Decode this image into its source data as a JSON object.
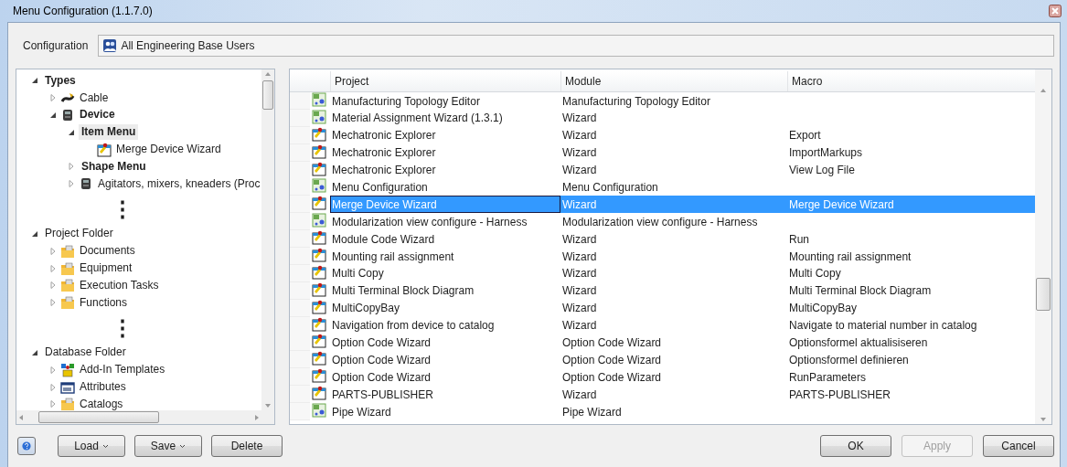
{
  "window": {
    "title": "Menu Configuration (1.1.7.0)"
  },
  "configuration": {
    "label": "Configuration",
    "value": "All Engineering Base Users"
  },
  "tree": [
    {
      "label": "Types",
      "bold": true,
      "expanded": true,
      "selected": false,
      "children": [
        {
          "label": "Cable",
          "kind": "cable",
          "bold": false,
          "expanded": false,
          "selected": false
        },
        {
          "label": "Device",
          "kind": "device",
          "bold": true,
          "expanded": true,
          "selected": false,
          "children": [
            {
              "label": "Item Menu",
              "bold": true,
              "expanded": true,
              "selected": true,
              "children": [
                {
                  "label": "Merge Device Wizard",
                  "kind": "wizard",
                  "bold": false,
                  "selected": false
                }
              ]
            },
            {
              "label": "Shape Menu",
              "bold": true,
              "expanded": false,
              "selected": false
            },
            {
              "label": "Agitators, mixers, kneaders (Proc",
              "kind": "device",
              "bold": false,
              "expanded": false,
              "selected": false
            },
            {
              "label": "⋮",
              "kind": "ellipsis"
            }
          ]
        }
      ]
    },
    {
      "label": "Project Folder",
      "bold": false,
      "expanded": true,
      "selected": false,
      "children": [
        {
          "label": "Documents",
          "kind": "folder",
          "bold": false,
          "expanded": false,
          "selected": false
        },
        {
          "label": "Equipment",
          "kind": "folder",
          "bold": false,
          "expanded": false,
          "selected": false
        },
        {
          "label": "Execution Tasks",
          "kind": "folder",
          "bold": false,
          "expanded": false,
          "selected": false
        },
        {
          "label": "Functions",
          "kind": "folder",
          "bold": false,
          "expanded": false,
          "selected": false
        },
        {
          "label": "⋮",
          "kind": "ellipsis"
        }
      ]
    },
    {
      "label": "Database Folder",
      "bold": false,
      "expanded": true,
      "selected": false,
      "children": [
        {
          "label": "Add-In Templates",
          "kind": "template",
          "bold": false,
          "expanded": false,
          "selected": false
        },
        {
          "label": "Attributes",
          "kind": "attributes",
          "bold": false,
          "expanded": false,
          "selected": false
        },
        {
          "label": "Catalogs",
          "kind": "folder",
          "bold": false,
          "expanded": false,
          "selected": false
        }
      ]
    }
  ],
  "table": {
    "columns": [
      "Project",
      "Module",
      "Macro"
    ],
    "rows": [
      {
        "kind": "module",
        "project": "Manufacturing Topology Editor",
        "module": "Manufacturing Topology Editor",
        "selected": false
      },
      {
        "kind": "module",
        "project": "Material Assignment Wizard (1.3.1)",
        "module": "Wizard",
        "selected": false
      },
      {
        "kind": "wizard",
        "project": "Mechatronic Explorer",
        "module": "Wizard",
        "macro": "Export",
        "selected": false
      },
      {
        "kind": "wizard",
        "project": "Mechatronic Explorer",
        "module": "Wizard",
        "macro": "ImportMarkups",
        "selected": false
      },
      {
        "kind": "wizard",
        "project": "Mechatronic Explorer",
        "module": "Wizard",
        "macro": "View Log File",
        "selected": false
      },
      {
        "kind": "module",
        "project": "Menu Configuration",
        "module": "Menu Configuration",
        "selected": false
      },
      {
        "kind": "wizard",
        "project": "Merge Device Wizard",
        "module": "Wizard",
        "macro": "Merge Device Wizard",
        "selected": true
      },
      {
        "kind": "module",
        "project": "Modularization view configure - Harness",
        "module": "Modularization view configure - Harness",
        "selected": false
      },
      {
        "kind": "wizard",
        "project": "Module Code Wizard",
        "module": "Wizard",
        "macro": "Run",
        "selected": false
      },
      {
        "kind": "wizard",
        "project": "Mounting rail assignment",
        "module": "Wizard",
        "macro": "Mounting rail assignment",
        "selected": false
      },
      {
        "kind": "wizard",
        "project": "Multi Copy",
        "module": "Wizard",
        "macro": "Multi Copy",
        "selected": false
      },
      {
        "kind": "wizard",
        "project": "Multi Terminal Block Diagram",
        "module": "Wizard",
        "macro": "Multi Terminal Block Diagram",
        "selected": false
      },
      {
        "kind": "wizard",
        "project": "MultiCopyBay",
        "module": "Wizard",
        "macro": "MultiCopyBay",
        "selected": false
      },
      {
        "kind": "wizard",
        "project": "Navigation from device to catalog",
        "module": "Wizard",
        "macro": "Navigate to material number in catalog",
        "selected": false
      },
      {
        "kind": "wizard",
        "project": "Option Code Wizard",
        "module": "Option Code Wizard",
        "macro": "Optionsformel aktualisiseren",
        "selected": false
      },
      {
        "kind": "wizard",
        "project": "Option Code Wizard",
        "module": "Option Code Wizard",
        "macro": "Optionsformel definieren",
        "selected": false
      },
      {
        "kind": "wizard",
        "project": "Option Code Wizard",
        "module": "Option Code Wizard",
        "macro": "RunParameters",
        "selected": false
      },
      {
        "kind": "wizard",
        "project": "PARTS-PUBLISHER",
        "module": "Wizard",
        "macro": "PARTS-PUBLISHER",
        "selected": false
      },
      {
        "kind": "module",
        "project": "Pipe Wizard",
        "module": "Pipe Wizard",
        "selected": false
      }
    ]
  },
  "left_buttons": [
    {
      "label": "Load",
      "menu": true
    },
    {
      "label": "Save",
      "menu": true
    },
    {
      "label": "Delete",
      "menu": false
    }
  ],
  "right_buttons": [
    {
      "label": "OK",
      "disabled": false
    },
    {
      "label": "Apply",
      "disabled": true
    },
    {
      "label": "Cancel",
      "disabled": false
    }
  ]
}
